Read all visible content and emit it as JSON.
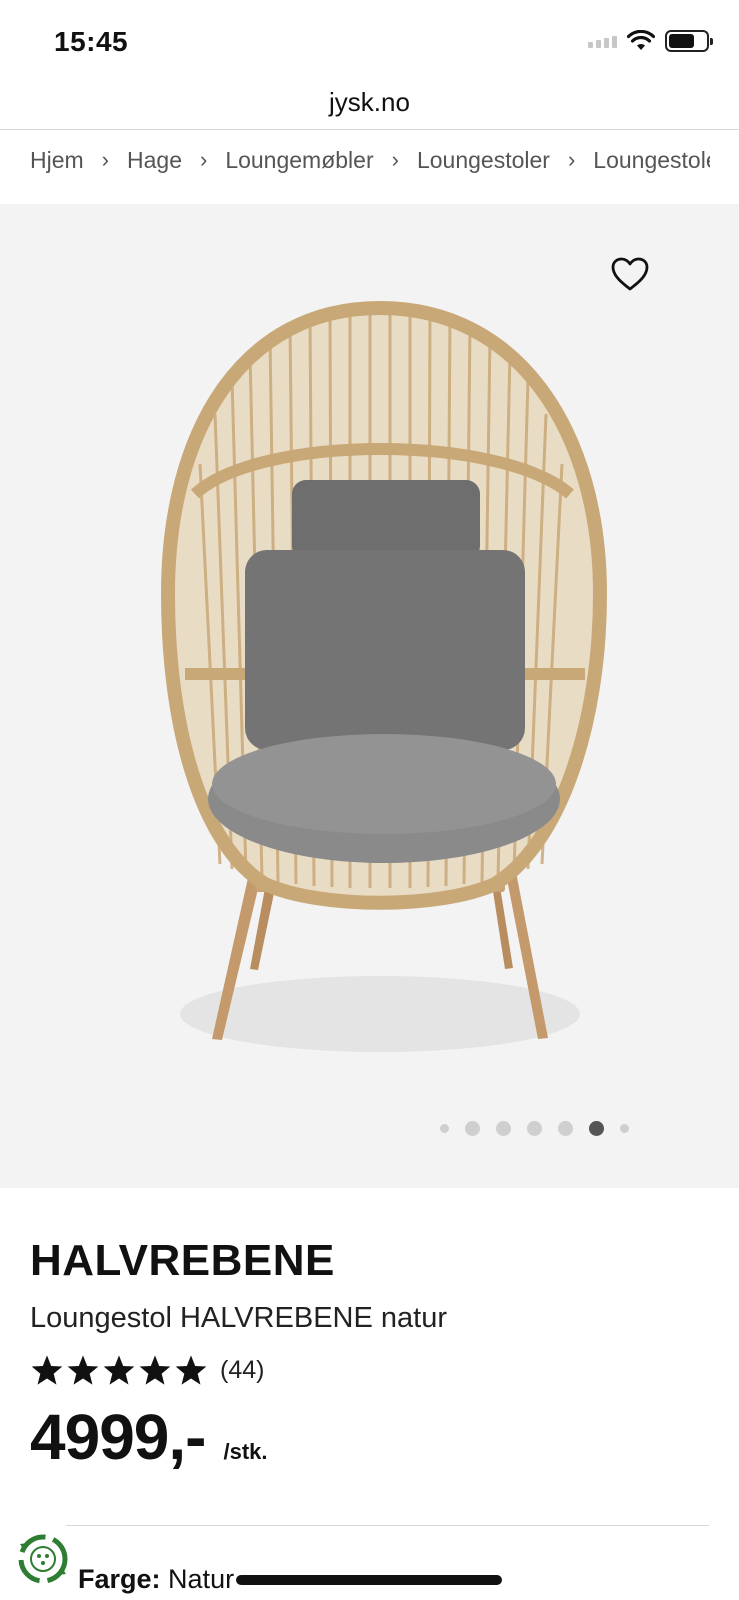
{
  "status_bar": {
    "time": "15:45"
  },
  "browser": {
    "url": "jysk.no"
  },
  "breadcrumb": {
    "items": [
      "Hjem",
      "Hage",
      "Loungemøbler",
      "Loungestoler",
      "Loungestoler"
    ]
  },
  "gallery": {
    "image_alt": "Loungestol HALVREBENE natur",
    "favorite_icon": "heart-outline-icon",
    "slide_count": 7,
    "active_slide": 5
  },
  "product": {
    "name": "HALVREBENE",
    "subtitle": "Loungestol HALVREBENE natur",
    "rating_stars": 5,
    "review_count": "(44)",
    "price": "4999,-",
    "unit": "/stk.",
    "color_label": "Farge:",
    "color_value": "Natur"
  },
  "colors": {
    "gallery_background": "#f3f3f3",
    "eco_badge": "#2e7d32",
    "text": "#111111"
  }
}
